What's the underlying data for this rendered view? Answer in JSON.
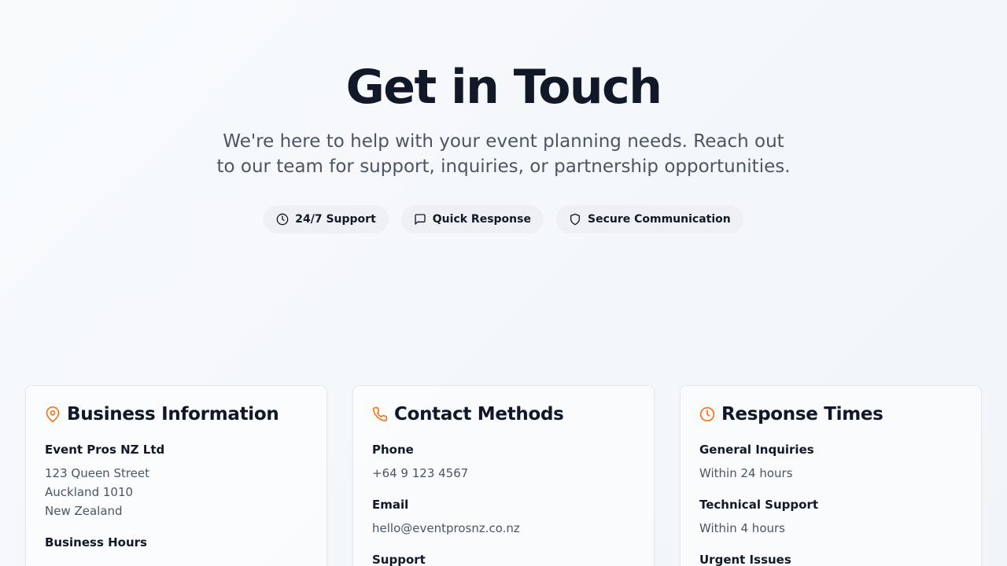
{
  "hero": {
    "title": "Get in Touch",
    "subtitle": "We're here to help with your event planning needs. Reach out to our team for support, inquiries, or partnership opportunities."
  },
  "badges": [
    {
      "icon": "clock-icon",
      "label": "24/7 Support"
    },
    {
      "icon": "message-square-icon",
      "label": "Quick Response"
    },
    {
      "icon": "shield-icon",
      "label": "Secure Communication"
    }
  ],
  "colors": {
    "accent": "#f97316",
    "heading": "#111827",
    "muted": "#4b5563",
    "badge_bg": "#eef0f3"
  },
  "business": {
    "icon": "map-pin-icon",
    "title": "Business Information",
    "company": "Event Pros NZ Ltd",
    "address": [
      "123 Queen Street",
      "Auckland 1010",
      "New Zealand"
    ],
    "hours_label": "Business Hours"
  },
  "contact": {
    "icon": "phone-icon",
    "title": "Contact Methods",
    "phone_label": "Phone",
    "phone_value": "+64 9 123 4567",
    "email_label": "Email",
    "email_value": "hello@eventprosnz.co.nz",
    "support_label": "Support"
  },
  "response": {
    "icon": "clock-icon",
    "title": "Response Times",
    "general_label": "General Inquiries",
    "general_value": "Within 24 hours",
    "technical_label": "Technical Support",
    "technical_value": "Within 4 hours",
    "urgent_label": "Urgent Issues"
  }
}
